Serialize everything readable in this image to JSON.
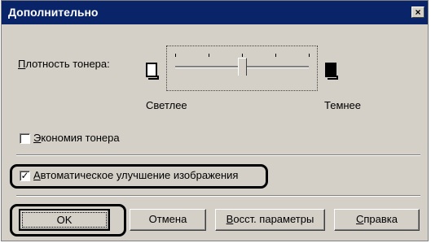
{
  "dialog": {
    "title": "Дополнительно",
    "close_label": "×"
  },
  "toner_density": {
    "label_prefix": "",
    "label_hotkey": "П",
    "label_rest": "лотность тонера:",
    "light_label": "Светлее",
    "dark_label": "Темнее",
    "level": 0.5
  },
  "toner_saving": {
    "label_hotkey": "Э",
    "label_rest": "кономия тонера",
    "checked": false
  },
  "auto_image_improve": {
    "label_hotkey": "А",
    "label_rest": "втоматическое улучшение изображения",
    "checked": true,
    "check_mark": "✓"
  },
  "buttons": {
    "ok": "OK",
    "cancel": "Отмена",
    "restore_hotkey": "В",
    "restore_rest": "осст. параметры",
    "help_hotkey": "С",
    "help_rest": "правка"
  }
}
